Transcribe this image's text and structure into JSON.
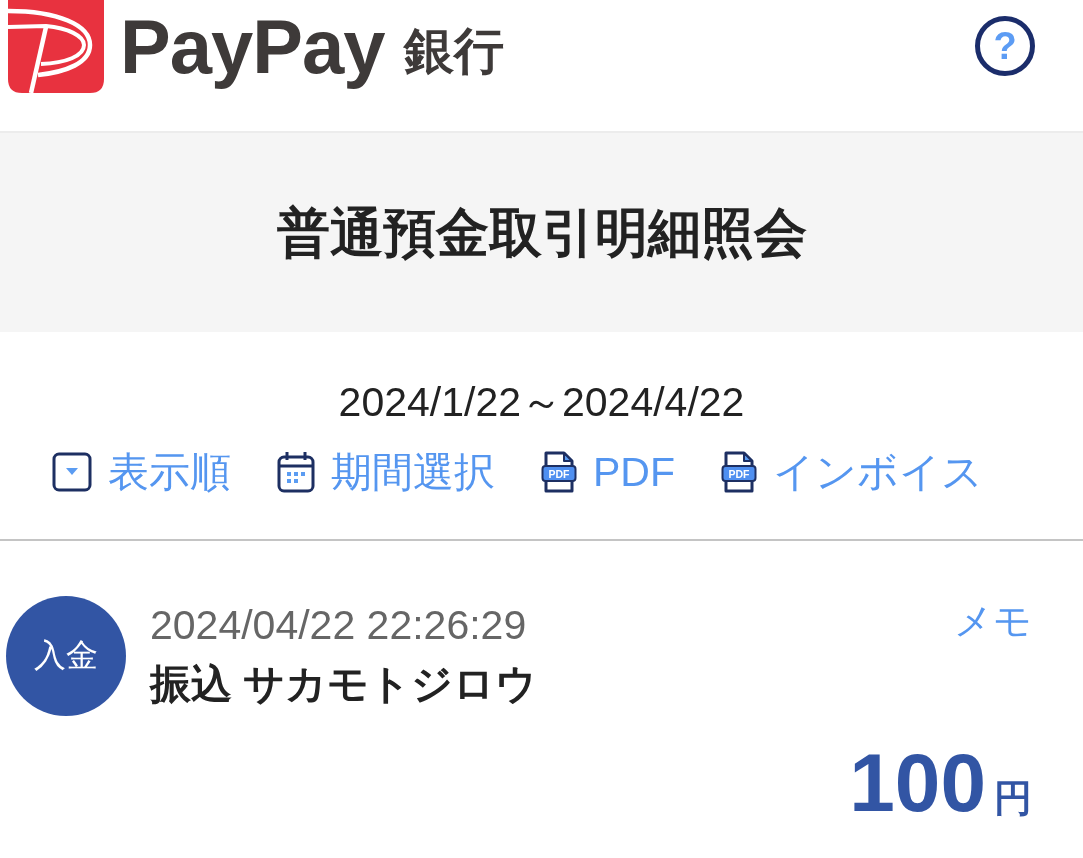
{
  "header": {
    "logo": {
      "name": "PayPay",
      "suffix": "銀行"
    },
    "help_button": {
      "label": "?"
    }
  },
  "page_title": "普通預金取引明細照会",
  "period": "2024/1/22～2024/4/22",
  "toolbar": [
    {
      "kind": "sort",
      "label": "表示順"
    },
    {
      "kind": "calendar",
      "label": "期間選択"
    },
    {
      "kind": "pdf",
      "icon_text": "PDF",
      "label": "PDF"
    },
    {
      "kind": "pdf",
      "icon_text": "PDF",
      "label": "インボイス"
    }
  ],
  "transactions": [
    {
      "type_badge": "入金",
      "datetime": "2024/04/22 22:26:29",
      "description": "振込 サカモトジロウ",
      "memo_link": "メモ",
      "amount": "100",
      "currency": "円"
    }
  ]
}
